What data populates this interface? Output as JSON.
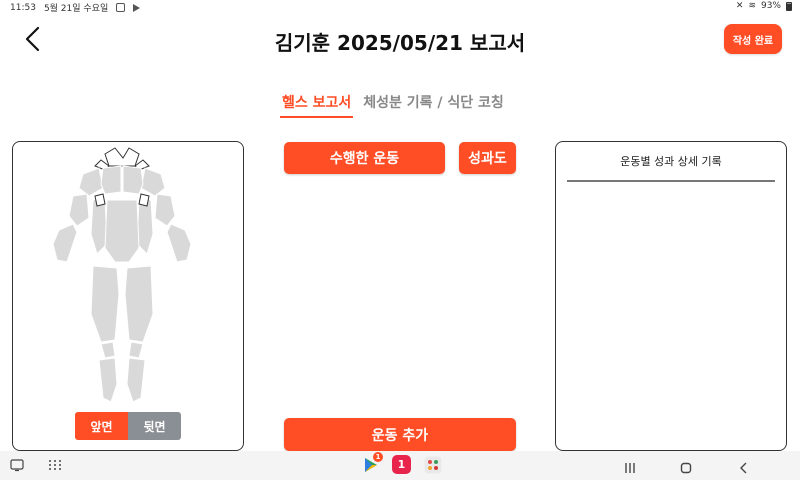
{
  "status_bar": {
    "time": "11:53",
    "date": "5월 21일 수요일",
    "battery": "93%"
  },
  "header": {
    "title": "김기훈 2025/05/21 보고서",
    "done_label": "작성 완료"
  },
  "tabs": [
    {
      "label": "헬스 보고서",
      "active": true
    },
    {
      "label": "체성분 기록 / 식단 코칭",
      "active": false
    }
  ],
  "body_view": {
    "front_label": "앞면",
    "back_label": "뒷면",
    "selected": "앞면"
  },
  "actions": {
    "exercises_label": "수행한 운동",
    "results_label": "성과도",
    "add_label": "운동 추가"
  },
  "detail_panel": {
    "title": "운동별 성과 상세 기록"
  },
  "nav_bar": {
    "play_store_badge": "1",
    "app_one_label": "1"
  },
  "colors": {
    "accent": "#ff4d25",
    "muscle": "#d9d9d9",
    "segment_inactive": "#8a8f95"
  }
}
